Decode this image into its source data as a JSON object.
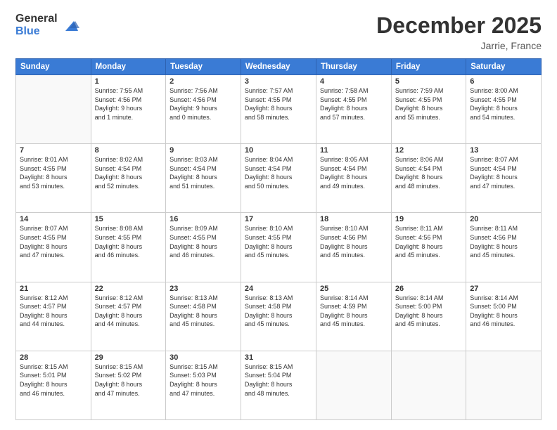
{
  "header": {
    "logo": {
      "general": "General",
      "blue": "Blue"
    },
    "title": "December 2025",
    "subtitle": "Jarrie, France"
  },
  "days_of_week": [
    "Sunday",
    "Monday",
    "Tuesday",
    "Wednesday",
    "Thursday",
    "Friday",
    "Saturday"
  ],
  "weeks": [
    [
      {
        "num": "",
        "info": ""
      },
      {
        "num": "1",
        "info": "Sunrise: 7:55 AM\nSunset: 4:56 PM\nDaylight: 9 hours\nand 1 minute."
      },
      {
        "num": "2",
        "info": "Sunrise: 7:56 AM\nSunset: 4:56 PM\nDaylight: 9 hours\nand 0 minutes."
      },
      {
        "num": "3",
        "info": "Sunrise: 7:57 AM\nSunset: 4:55 PM\nDaylight: 8 hours\nand 58 minutes."
      },
      {
        "num": "4",
        "info": "Sunrise: 7:58 AM\nSunset: 4:55 PM\nDaylight: 8 hours\nand 57 minutes."
      },
      {
        "num": "5",
        "info": "Sunrise: 7:59 AM\nSunset: 4:55 PM\nDaylight: 8 hours\nand 55 minutes."
      },
      {
        "num": "6",
        "info": "Sunrise: 8:00 AM\nSunset: 4:55 PM\nDaylight: 8 hours\nand 54 minutes."
      }
    ],
    [
      {
        "num": "7",
        "info": "Sunrise: 8:01 AM\nSunset: 4:55 PM\nDaylight: 8 hours\nand 53 minutes."
      },
      {
        "num": "8",
        "info": "Sunrise: 8:02 AM\nSunset: 4:54 PM\nDaylight: 8 hours\nand 52 minutes."
      },
      {
        "num": "9",
        "info": "Sunrise: 8:03 AM\nSunset: 4:54 PM\nDaylight: 8 hours\nand 51 minutes."
      },
      {
        "num": "10",
        "info": "Sunrise: 8:04 AM\nSunset: 4:54 PM\nDaylight: 8 hours\nand 50 minutes."
      },
      {
        "num": "11",
        "info": "Sunrise: 8:05 AM\nSunset: 4:54 PM\nDaylight: 8 hours\nand 49 minutes."
      },
      {
        "num": "12",
        "info": "Sunrise: 8:06 AM\nSunset: 4:54 PM\nDaylight: 8 hours\nand 48 minutes."
      },
      {
        "num": "13",
        "info": "Sunrise: 8:07 AM\nSunset: 4:54 PM\nDaylight: 8 hours\nand 47 minutes."
      }
    ],
    [
      {
        "num": "14",
        "info": "Sunrise: 8:07 AM\nSunset: 4:55 PM\nDaylight: 8 hours\nand 47 minutes."
      },
      {
        "num": "15",
        "info": "Sunrise: 8:08 AM\nSunset: 4:55 PM\nDaylight: 8 hours\nand 46 minutes."
      },
      {
        "num": "16",
        "info": "Sunrise: 8:09 AM\nSunset: 4:55 PM\nDaylight: 8 hours\nand 46 minutes."
      },
      {
        "num": "17",
        "info": "Sunrise: 8:10 AM\nSunset: 4:55 PM\nDaylight: 8 hours\nand 45 minutes."
      },
      {
        "num": "18",
        "info": "Sunrise: 8:10 AM\nSunset: 4:56 PM\nDaylight: 8 hours\nand 45 minutes."
      },
      {
        "num": "19",
        "info": "Sunrise: 8:11 AM\nSunset: 4:56 PM\nDaylight: 8 hours\nand 45 minutes."
      },
      {
        "num": "20",
        "info": "Sunrise: 8:11 AM\nSunset: 4:56 PM\nDaylight: 8 hours\nand 45 minutes."
      }
    ],
    [
      {
        "num": "21",
        "info": "Sunrise: 8:12 AM\nSunset: 4:57 PM\nDaylight: 8 hours\nand 44 minutes."
      },
      {
        "num": "22",
        "info": "Sunrise: 8:12 AM\nSunset: 4:57 PM\nDaylight: 8 hours\nand 44 minutes."
      },
      {
        "num": "23",
        "info": "Sunrise: 8:13 AM\nSunset: 4:58 PM\nDaylight: 8 hours\nand 45 minutes."
      },
      {
        "num": "24",
        "info": "Sunrise: 8:13 AM\nSunset: 4:58 PM\nDaylight: 8 hours\nand 45 minutes."
      },
      {
        "num": "25",
        "info": "Sunrise: 8:14 AM\nSunset: 4:59 PM\nDaylight: 8 hours\nand 45 minutes."
      },
      {
        "num": "26",
        "info": "Sunrise: 8:14 AM\nSunset: 5:00 PM\nDaylight: 8 hours\nand 45 minutes."
      },
      {
        "num": "27",
        "info": "Sunrise: 8:14 AM\nSunset: 5:00 PM\nDaylight: 8 hours\nand 46 minutes."
      }
    ],
    [
      {
        "num": "28",
        "info": "Sunrise: 8:15 AM\nSunset: 5:01 PM\nDaylight: 8 hours\nand 46 minutes."
      },
      {
        "num": "29",
        "info": "Sunrise: 8:15 AM\nSunset: 5:02 PM\nDaylight: 8 hours\nand 47 minutes."
      },
      {
        "num": "30",
        "info": "Sunrise: 8:15 AM\nSunset: 5:03 PM\nDaylight: 8 hours\nand 47 minutes."
      },
      {
        "num": "31",
        "info": "Sunrise: 8:15 AM\nSunset: 5:04 PM\nDaylight: 8 hours\nand 48 minutes."
      },
      {
        "num": "",
        "info": ""
      },
      {
        "num": "",
        "info": ""
      },
      {
        "num": "",
        "info": ""
      }
    ]
  ]
}
